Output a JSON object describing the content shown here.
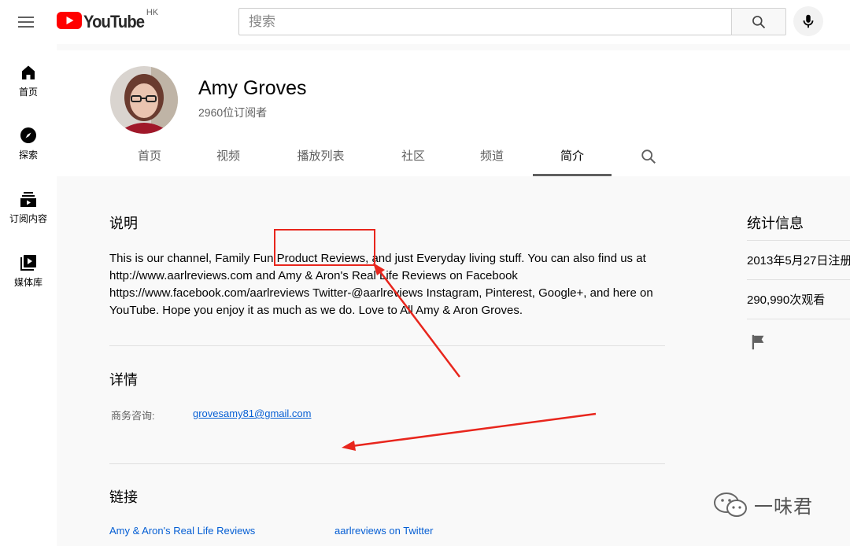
{
  "header": {
    "logo_text": "YouTube",
    "region": "HK",
    "search_placeholder": "搜索"
  },
  "sidebar": {
    "items": [
      {
        "label": "首页",
        "icon": "home-icon"
      },
      {
        "label": "探索",
        "icon": "compass-icon"
      },
      {
        "label": "订阅内容",
        "icon": "subscriptions-icon"
      },
      {
        "label": "媒体库",
        "icon": "library-icon"
      }
    ]
  },
  "channel": {
    "name": "Amy Groves",
    "subscribers": "2960位订阅者",
    "tabs": [
      "首页",
      "视频",
      "播放列表",
      "社区",
      "频道",
      "简介"
    ],
    "active_tab": "简介"
  },
  "about": {
    "description_title": "说明",
    "description": "This is our channel, Family Fun Product Reviews, and just Everyday living stuff. You can also find us at http://www.aarlreviews.com and Amy & Aron's Real Life Reviews on Facebook https://www.facebook.com/aarlreviews Twitter-@aarlreviews Instagram, Pinterest, Google+, and here on YouTube. Hope you enjoy it as much as we do.  Love to All Amy & Aron Groves.",
    "details_title": "详情",
    "business_label": "商务咨询:",
    "business_email": "grovesamy81@gmail.com",
    "links_title": "链接",
    "links": [
      "Amy & Aron's Real Life Reviews",
      "aarlreviews on Twitter"
    ]
  },
  "stats": {
    "title": "统计信息",
    "joined": "2013年5月27日注册",
    "views": "290,990次观看"
  },
  "watermark": {
    "text": "一味君"
  },
  "colors": {
    "youtube_red": "#ff0000",
    "link_blue": "#065fd4",
    "annotation_red": "#e8261d"
  }
}
